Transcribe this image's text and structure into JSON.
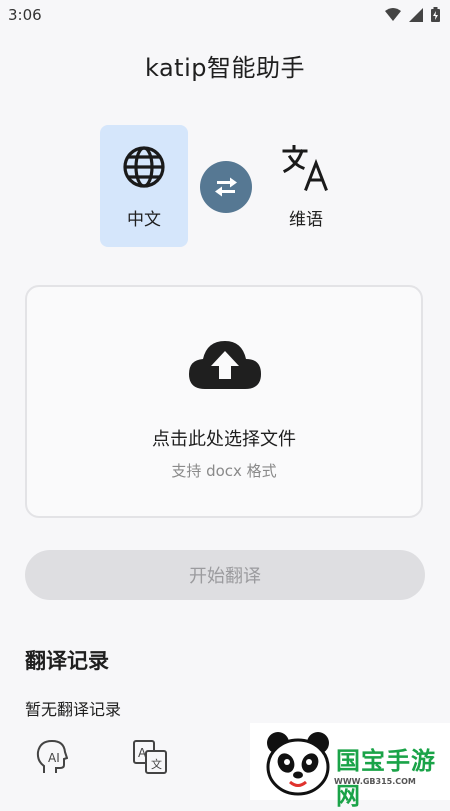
{
  "status_bar": {
    "time": "3:06"
  },
  "app_title": "katip智能助手",
  "languages": {
    "source": {
      "label": "中文",
      "icon": "globe-icon"
    },
    "target": {
      "label": "维语",
      "icon": "translate-icon"
    },
    "swap_icon": "swap-arrows-icon"
  },
  "upload": {
    "title": "点击此处选择文件",
    "subtitle": "支持 docx 格式",
    "icon": "cloud-upload-icon"
  },
  "start_button": {
    "label": "开始翻译",
    "state": "disabled"
  },
  "history": {
    "title": "翻译记录",
    "empty_text": "暂无翻译记录"
  },
  "bottom_nav": [
    {
      "icon": "ai-head-icon"
    },
    {
      "icon": "translate-doc-icon"
    }
  ],
  "watermark": {
    "text": "国宝手游网",
    "url": "WWW.GB315.COM"
  },
  "colors": {
    "accent_card": "#d5e6fb",
    "swap_button": "#567893",
    "disabled_button": "#dedee1"
  }
}
